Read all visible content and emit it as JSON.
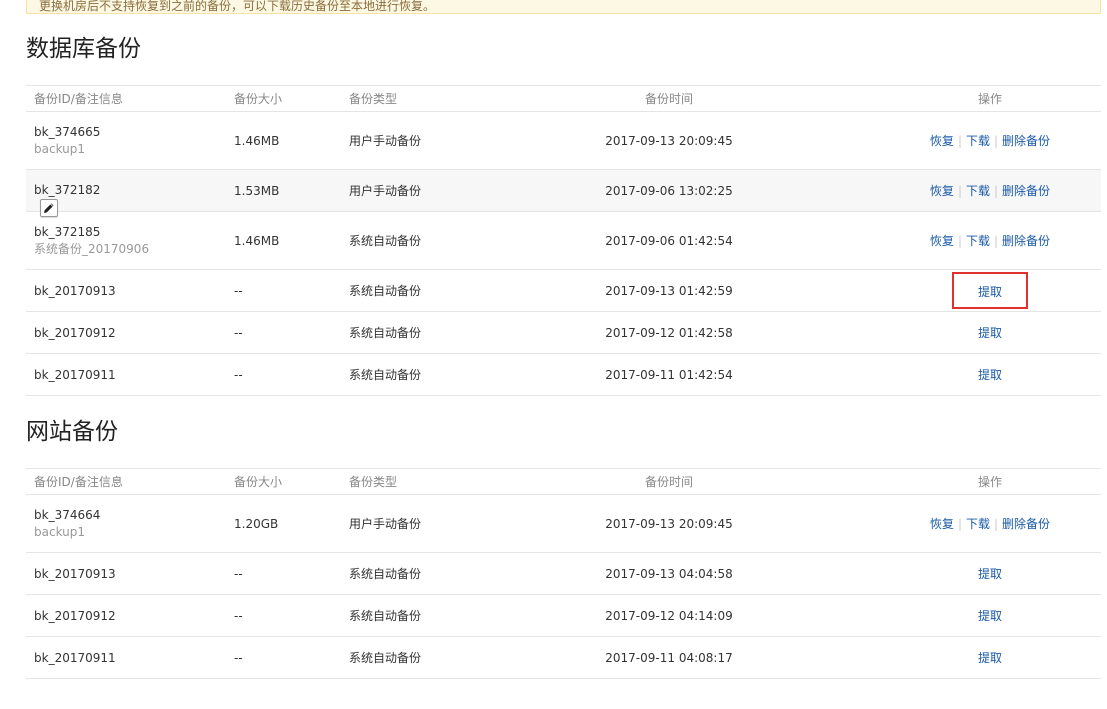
{
  "notice": {
    "text": "更换机房后不支持恢复到之前的备份，可以下载历史备份至本地进行恢复。"
  },
  "db_section": {
    "title": "数据库备份",
    "headers": [
      "备份ID/备注信息",
      "备份大小",
      "备份类型",
      "备份时间",
      "操作"
    ],
    "rows": [
      {
        "id": "bk_374665",
        "note": "backup1",
        "size": "1.46MB",
        "type": "用户手动备份",
        "time": "2017-09-13 20:09:45",
        "actions": [
          "恢复",
          "下载",
          "删除备份"
        ]
      },
      {
        "id": "bk_372182",
        "note": "",
        "size": "1.53MB",
        "type": "用户手动备份",
        "time": "2017-09-06 13:02:25",
        "actions": [
          "恢复",
          "下载",
          "删除备份"
        ]
      },
      {
        "id": "bk_372185",
        "note": "系统备份_20170906",
        "size": "1.46MB",
        "type": "系统自动备份",
        "time": "2017-09-06 01:42:54",
        "actions": [
          "恢复",
          "下载",
          "删除备份"
        ]
      },
      {
        "id": "bk_20170913",
        "note": "",
        "size": "--",
        "type": "系统自动备份",
        "time": "2017-09-13 01:42:59",
        "actions": [
          "提取"
        ]
      },
      {
        "id": "bk_20170912",
        "note": "",
        "size": "--",
        "type": "系统自动备份",
        "time": "2017-09-12 01:42:58",
        "actions": [
          "提取"
        ]
      },
      {
        "id": "bk_20170911",
        "note": "",
        "size": "--",
        "type": "系统自动备份",
        "time": "2017-09-11 01:42:54",
        "actions": [
          "提取"
        ]
      }
    ]
  },
  "site_section": {
    "title": "网站备份",
    "headers": [
      "备份ID/备注信息",
      "备份大小",
      "备份类型",
      "备份时间",
      "操作"
    ],
    "rows": [
      {
        "id": "bk_374664",
        "note": "backup1",
        "size": "1.20GB",
        "type": "用户手动备份",
        "time": "2017-09-13 20:09:45",
        "actions": [
          "恢复",
          "下载",
          "删除备份"
        ]
      },
      {
        "id": "bk_20170913",
        "note": "",
        "size": "--",
        "type": "系统自动备份",
        "time": "2017-09-13 04:04:58",
        "actions": [
          "提取"
        ]
      },
      {
        "id": "bk_20170912",
        "note": "",
        "size": "--",
        "type": "系统自动备份",
        "time": "2017-09-12 04:14:09",
        "actions": [
          "提取"
        ]
      },
      {
        "id": "bk_20170911",
        "note": "",
        "size": "--",
        "type": "系统自动备份",
        "time": "2017-09-11 04:08:17",
        "actions": [
          "提取"
        ]
      }
    ]
  },
  "colors": {
    "link": "#1a5aa6",
    "highlight_box": "#e03131",
    "notice_bg": "#fcf8e3"
  }
}
